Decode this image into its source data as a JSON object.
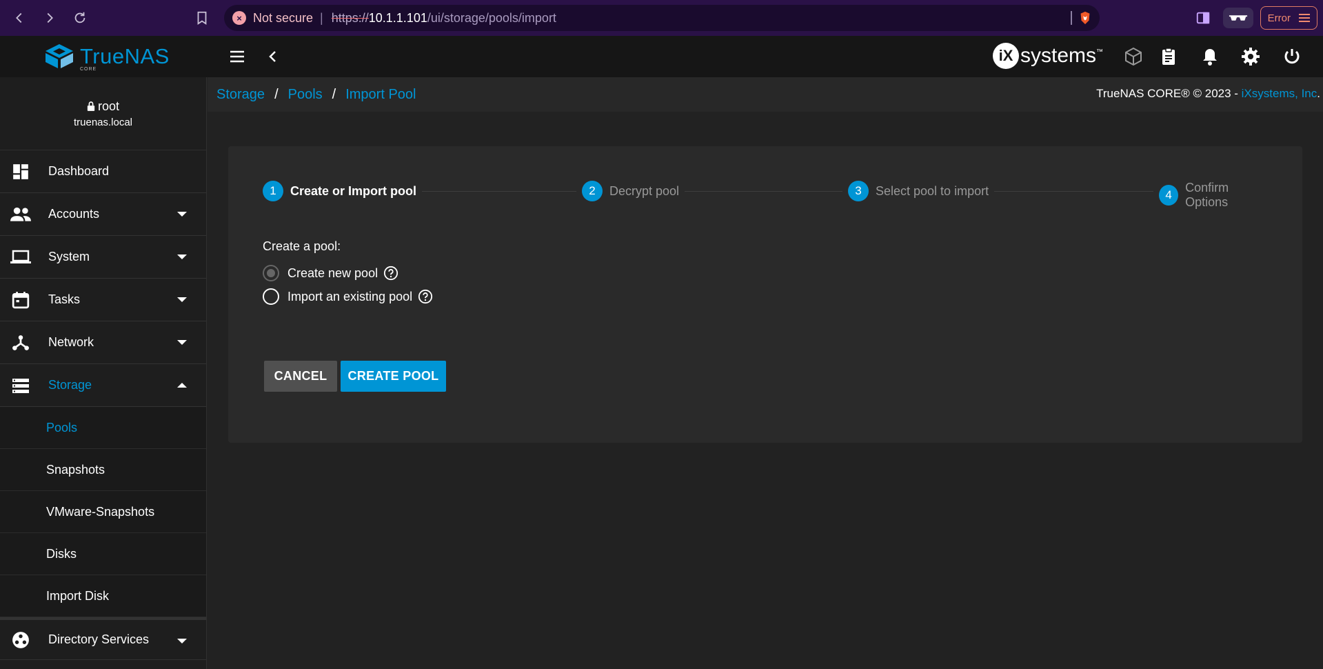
{
  "browser": {
    "security_label": "Not secure",
    "url_scheme": "https://",
    "url_host": "10.1.1.101",
    "url_path": "/ui/storage/pools/import",
    "error_label": "Error"
  },
  "app": {
    "logo_true": "True",
    "logo_nas": "NAS",
    "logo_sub": "CORE",
    "vendor_logo_i": "iX",
    "vendor_logo_rest": "systems",
    "vendor_logo_tm": "™"
  },
  "user": {
    "name": "root",
    "host": "truenas.local"
  },
  "sidebar": {
    "items": [
      {
        "label": "Dashboard"
      },
      {
        "label": "Accounts"
      },
      {
        "label": "System"
      },
      {
        "label": "Tasks"
      },
      {
        "label": "Network"
      },
      {
        "label": "Storage"
      }
    ],
    "storage_sub": [
      {
        "label": "Pools"
      },
      {
        "label": "Snapshots"
      },
      {
        "label": "VMware-Snapshots"
      },
      {
        "label": "Disks"
      },
      {
        "label": "Import Disk"
      }
    ],
    "directory_services": "Directory Services"
  },
  "breadcrumb": [
    "Storage",
    "Pools",
    "Import Pool"
  ],
  "copyright": {
    "text": "TrueNAS CORE® © 2023 - ",
    "link": "iXsystems, Inc",
    "end": "."
  },
  "stepper": [
    {
      "num": "1",
      "label": "Create or Import pool"
    },
    {
      "num": "2",
      "label": "Decrypt pool"
    },
    {
      "num": "3",
      "label": "Select pool to import"
    },
    {
      "num": "4",
      "label": "Confirm Options"
    }
  ],
  "form": {
    "label": "Create a pool:",
    "options": [
      "Create new pool",
      "Import an existing pool"
    ],
    "selected": "Create new pool"
  },
  "buttons": {
    "cancel": "CANCEL",
    "create": "CREATE POOL"
  },
  "colors": {
    "accent": "#0095d5",
    "browser_chrome": "#2a1147"
  }
}
